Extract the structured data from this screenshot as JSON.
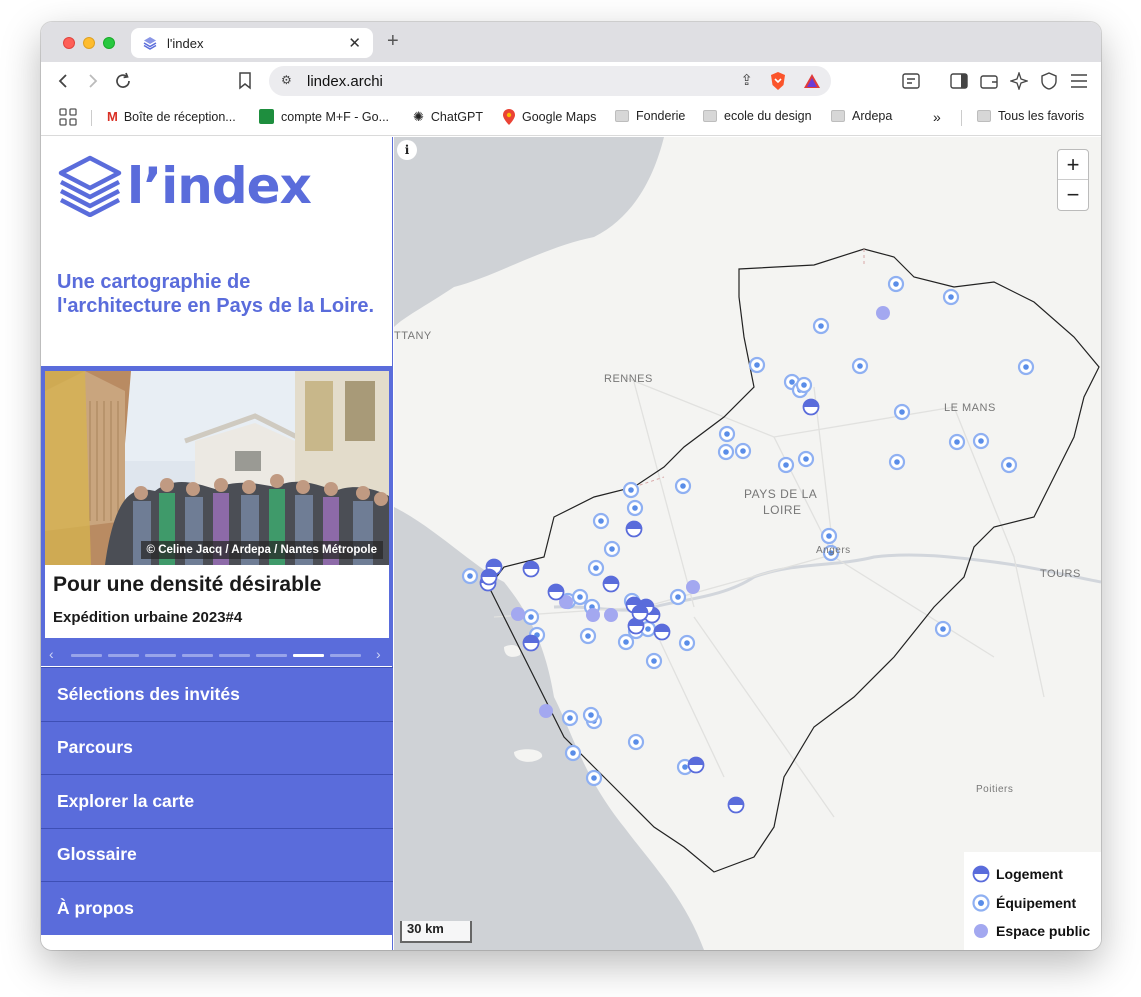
{
  "browser": {
    "tab_title": "l'index",
    "url": "lindex.archi",
    "bookmarks": [
      {
        "label": "Boîte de réception..."
      },
      {
        "label": "compte M+F - Go..."
      },
      {
        "label": "ChatGPT"
      },
      {
        "label": "Google Maps"
      },
      {
        "label": "Fonderie"
      },
      {
        "label": "ecole du design"
      },
      {
        "label": "Ardepa"
      }
    ],
    "more_bookmarks": "»",
    "all_bookmarks": "Tous les favoris"
  },
  "site": {
    "logo_text": "l’index",
    "tagline": "Une cartographie de l'architecture en Pays de la Loire."
  },
  "featured": {
    "credit": "© Celine Jacq / Ardepa / Nantes Métropole",
    "title": "Pour une densité désirable",
    "subtitle": "Expédition urbaine 2023#4",
    "slide_count": 8,
    "active_slide": 7
  },
  "menu": [
    {
      "label": "Sélections des invités"
    },
    {
      "label": "Parcours"
    },
    {
      "label": "Explorer la carte"
    },
    {
      "label": "Glossaire"
    },
    {
      "label": "À propos"
    }
  ],
  "map": {
    "zoom_in": "+",
    "zoom_out": "−",
    "info": "i",
    "scale": "30 km",
    "labels": {
      "ttany": "TTANY",
      "rennes": "RENNES",
      "le_mans": "LE MANS",
      "pays_line1": "PAYS DE LA",
      "pays_line2": "LOIRE",
      "angers": "Angers",
      "tours": "TOURS",
      "poitiers": "Poitiers"
    },
    "legend": [
      {
        "label": "Logement",
        "type": "logement"
      },
      {
        "label": "Équipement",
        "type": "equipement"
      },
      {
        "label": "Espace public",
        "type": "espace"
      }
    ],
    "colors": {
      "primary": "#5a6cdb",
      "light": "#8fb0f2",
      "espace": "#a3a8f0"
    }
  }
}
